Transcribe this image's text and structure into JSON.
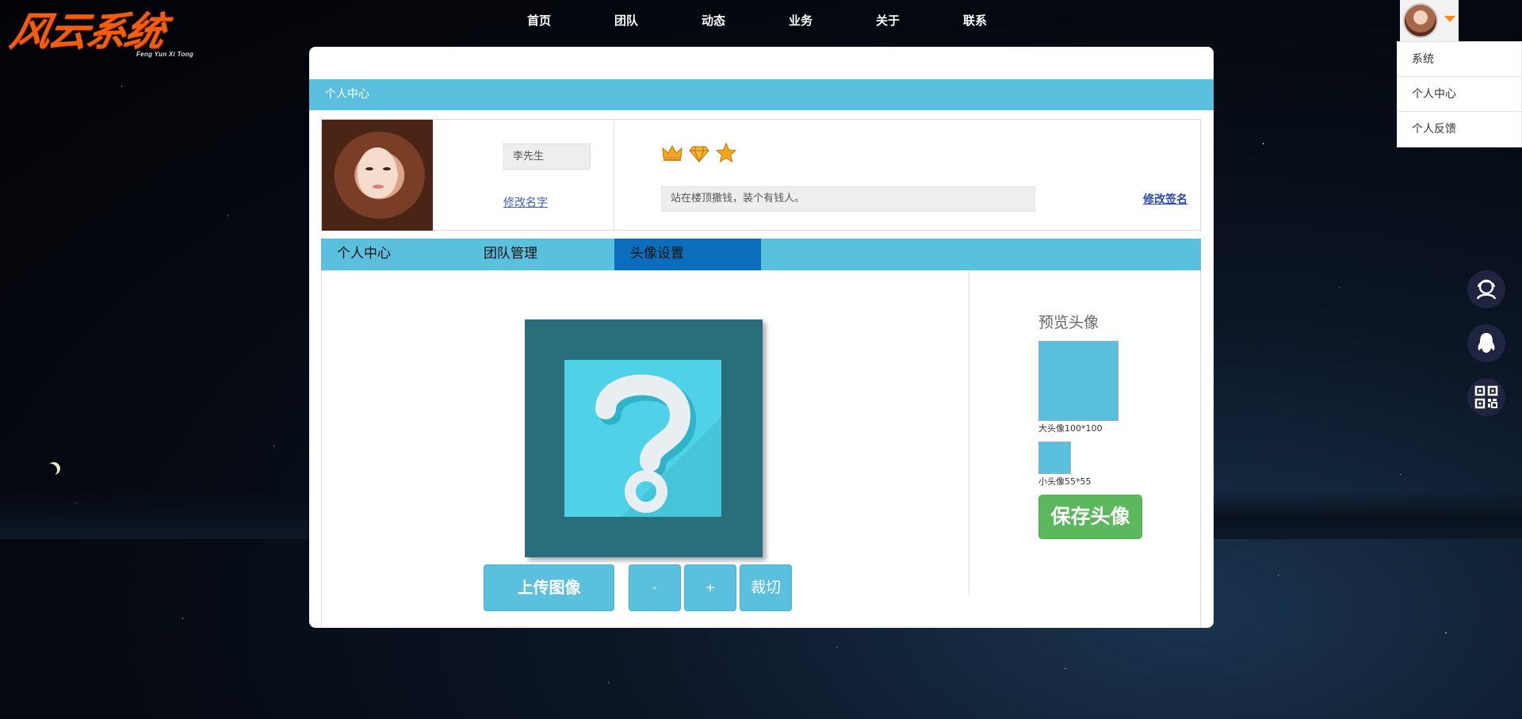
{
  "brand": {
    "logo_text": "风云系统",
    "logo_subtitle": "Feng Yun Xi Tong",
    "accent": "#f25d12"
  },
  "topnav": {
    "items": [
      "首页",
      "团队",
      "动态",
      "业务",
      "关于",
      "联系"
    ]
  },
  "user_menu": {
    "avatar_icon": "user-avatar-icon",
    "items": [
      "系统",
      "个人中心",
      "个人反馈"
    ]
  },
  "panel": {
    "title": "个人中心",
    "profile": {
      "name": "李先生",
      "rename_link": "修改名字",
      "badges": [
        "crown-icon",
        "diamond-icon",
        "star-icon"
      ],
      "signature": "站在楼顶撒钱，装个有钱人。",
      "edit_signature": "修改签名"
    },
    "tabs": [
      "个人中心",
      "团队管理",
      "头像设置"
    ],
    "active_tab": "头像设置",
    "avatar_editor": {
      "placeholder_icon": "question-mark-icon",
      "upload_label": "上传图像",
      "zoom_out_label": "-",
      "zoom_in_label": "+",
      "crop_label": "裁切"
    },
    "preview": {
      "title": "预览头像",
      "big_label": "大头像100*100",
      "small_label": "小头像55*55",
      "save_label": "保存头像"
    }
  },
  "side_buttons": [
    "customer-service-icon",
    "qq-penguin-icon",
    "qr-code-icon"
  ],
  "colors": {
    "primary": "#5bc0de",
    "active_tab": "#0a6ebd",
    "save": "#5cb85c"
  }
}
